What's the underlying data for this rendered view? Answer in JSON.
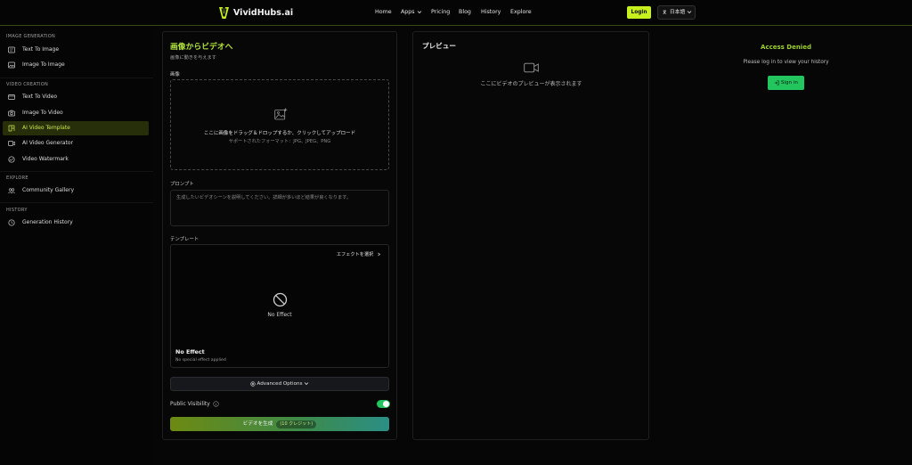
{
  "header": {
    "brand": "VividHubs.ai",
    "nav": [
      {
        "label": "Home"
      },
      {
        "label": "Apps"
      },
      {
        "label": "Pricing"
      },
      {
        "label": "Blog"
      },
      {
        "label": "History"
      },
      {
        "label": "Explore"
      }
    ],
    "login_label": "Login",
    "language_label": "日本語"
  },
  "sidebar": {
    "sections": [
      {
        "title": "IMAGE GENERATION",
        "items": [
          {
            "label": "Text To Image",
            "icon": "text-image-icon"
          },
          {
            "label": "Image To Image",
            "icon": "image-icon"
          }
        ]
      },
      {
        "title": "VIDEO CREATION",
        "items": [
          {
            "label": "Text To Video",
            "icon": "video-icon"
          },
          {
            "label": "Image To Video",
            "icon": "camera-icon"
          },
          {
            "label": "AI Video Template",
            "icon": "template-icon",
            "active": true
          },
          {
            "label": "AI Video Generator",
            "icon": "film-icon"
          },
          {
            "label": "Video Watermark",
            "icon": "watermark-icon"
          }
        ]
      },
      {
        "title": "EXPLORE",
        "items": [
          {
            "label": "Community Gallery",
            "icon": "gallery-icon"
          }
        ]
      },
      {
        "title": "HISTORY",
        "items": [
          {
            "label": "Generation History",
            "icon": "clock-icon"
          }
        ]
      }
    ]
  },
  "form": {
    "title": "画像からビデオへ",
    "subtitle": "画像に動きを与えます",
    "image_label": "画像",
    "dropzone_text": "ここに画像をドラッグ＆ドロップするか、クリックしてアップロード",
    "dropzone_formats": "サポートされたフォーマット：JPG、JPEG、PNG",
    "prompt_label": "プロンプト",
    "prompt_placeholder": "生成したいビデオシーンを説明してください。詳細が多いほど結果が良くなります。",
    "template_label": "テンプレート",
    "select_effect_label": "エフェクトを選択",
    "no_effect_label": "No Effect",
    "no_effect_title": "No Effect",
    "no_effect_desc": "No special effect applied",
    "advanced_label": "Advanced Options",
    "public_visibility_label": "Public Visibility",
    "public_visibility_on": true,
    "generate_label": "ビデオを生成",
    "generate_badge": "(10 クレジット)"
  },
  "preview": {
    "title": "プレビュー",
    "placeholder": "ここにビデオのプレビューが表示されます"
  },
  "history_panel": {
    "title": "Access Denied",
    "message": "Please log in to view your history",
    "signin_label": "Sign in"
  },
  "colors": {
    "accent": "#c6f01e",
    "title_green": "#b4e63c",
    "active_bg": "#262e0a",
    "toggle_green": "#22c55e"
  }
}
